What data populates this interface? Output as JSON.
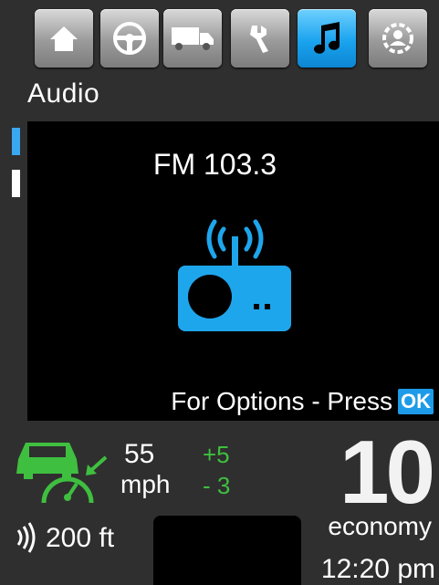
{
  "tabs": [
    {
      "icon": "home-icon"
    },
    {
      "icon": "steering-wheel-icon"
    },
    {
      "icon": "truck-icon"
    },
    {
      "icon": "wrench-icon"
    },
    {
      "icon": "music-note-icon",
      "active": true
    },
    {
      "icon": "settings-user-icon"
    }
  ],
  "screen": {
    "title": "Audio"
  },
  "audio": {
    "station": "FM 103.3",
    "radio_icon": "radio-broadcast-icon",
    "options_text": "For Options - Press",
    "ok_label": "OK"
  },
  "status": {
    "speed_value": "55",
    "speed_unit": "mph",
    "speed_delta_up": "+5",
    "speed_delta_down": "- 3",
    "distance": "200 ft",
    "economy_value": "10",
    "economy_label": "economy",
    "time": "12:20 pm"
  },
  "colors": {
    "active_tab": "#1aa3ee",
    "accent_blue": "#1e9be8",
    "cruise_green": "#3fbf3f",
    "background": "#2f2f2f",
    "panel": "#000000"
  }
}
